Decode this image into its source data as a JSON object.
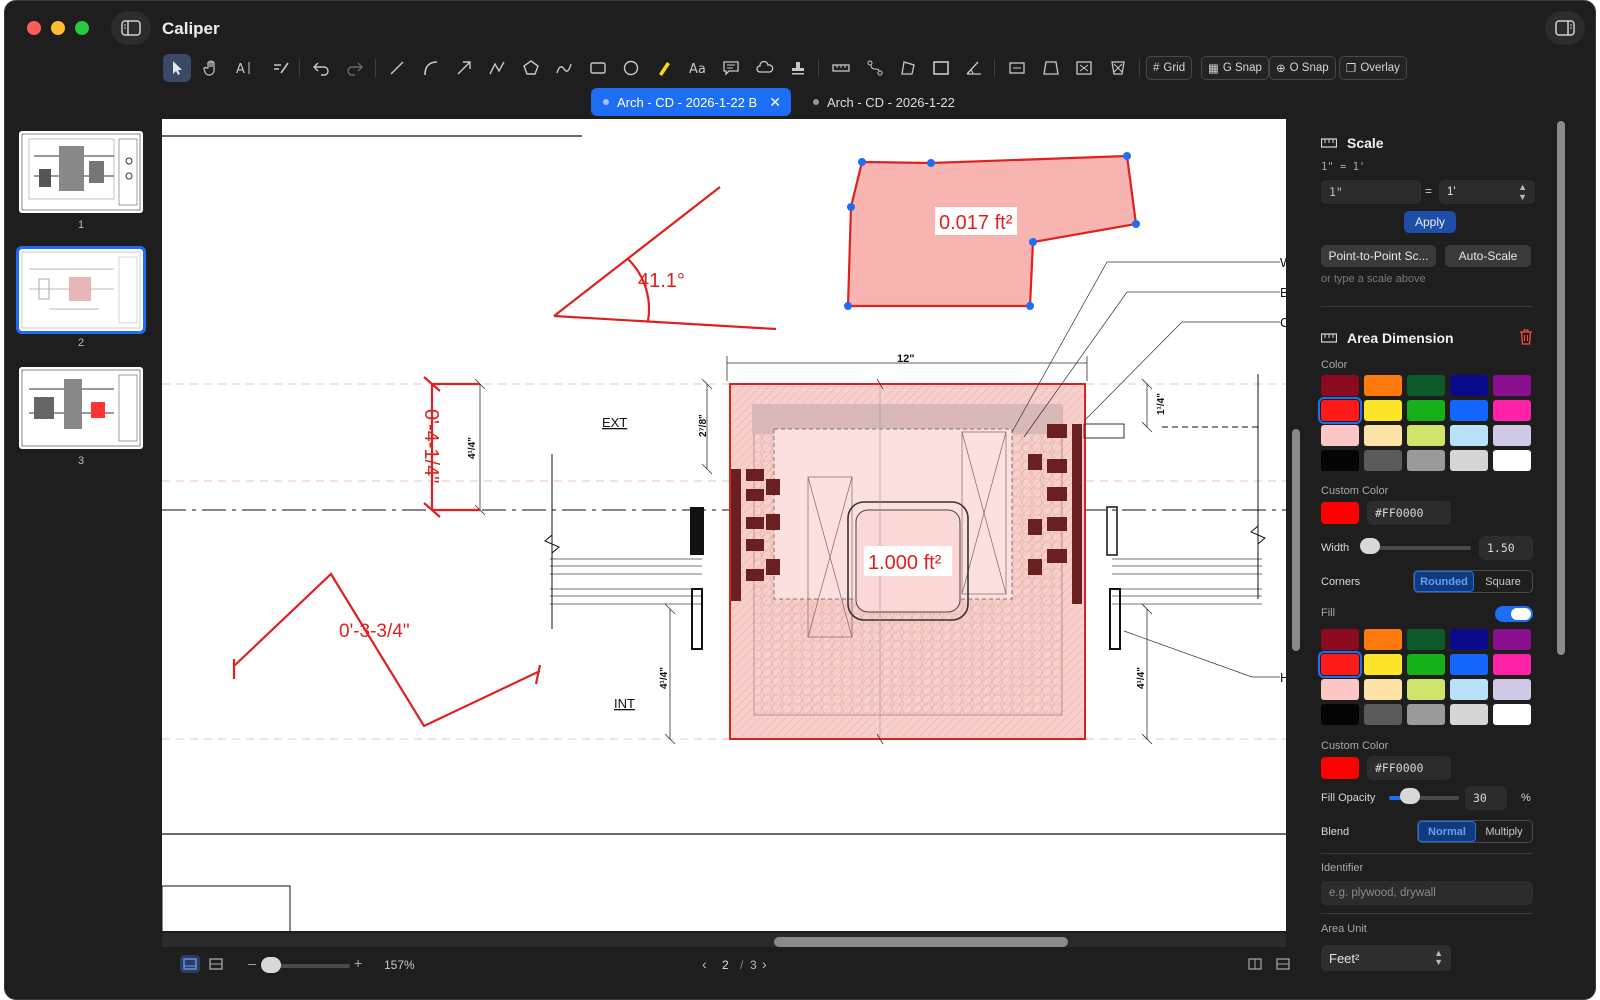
{
  "app": {
    "title": "Caliper"
  },
  "toolbar": {
    "tools": [
      "select-arrow-icon",
      "hand-pan-icon",
      "text-select-icon",
      "markup-pen-icon",
      "undo-icon",
      "redo-icon",
      "line-icon",
      "arc-icon",
      "arrow-icon",
      "polyline-icon",
      "polygon-icon",
      "freehand-icon",
      "rectangle-icon",
      "ellipse-icon",
      "highlighter-icon",
      "text-icon",
      "comment-icon",
      "cloud-icon",
      "stamp-icon",
      "ruler-icon",
      "path-measure-icon",
      "area-polygon-icon",
      "rect-area-icon",
      "angle-icon",
      "dimension-icon",
      "perimeter-icon",
      "cutout-icon",
      "count-icon"
    ],
    "grid_label": "Grid",
    "gsnap_label": "G Snap",
    "osnap_label": "O Snap",
    "overlay_label": "Overlay"
  },
  "tabs": [
    {
      "label": "Arch - CD - 2026-1-22 B",
      "active": true
    },
    {
      "label": "Arch - CD - 2026-1-22",
      "active": false
    }
  ],
  "thumbnails": [
    {
      "page": "1"
    },
    {
      "page": "2",
      "selected": true
    },
    {
      "page": "3"
    }
  ],
  "canvas": {
    "area_small": "0.017 ft²",
    "area_large": "1.000 ft²",
    "angle": "41.1°",
    "dim_vertical_red": "0'-4-1/4\"",
    "dim_zigzag": "0'-3-3/4\"",
    "dim_top": "12\"",
    "dim_left_small": "2⁷/8\"",
    "dim_4_1_4": "4¹/4\"",
    "dim_1_1_4": "1¹/4\"",
    "label_ext": "EXT",
    "label_int": "INT",
    "callouts": [
      "W",
      "B",
      "C",
      "H"
    ]
  },
  "statusbar": {
    "zoom": "157%",
    "zoom_level_pct": 8,
    "page_current": "2",
    "page_sep": "/",
    "page_total": "3"
  },
  "scale": {
    "title": "Scale",
    "current": "1\" = 1'",
    "input_left": "1\"",
    "equals": "=",
    "input_right": "1'",
    "apply": "Apply",
    "point_to_point": "Point-to-Point Sc...",
    "auto_scale": "Auto-Scale",
    "hint": "or type a scale above"
  },
  "area_dimension": {
    "title": "Area Dimension",
    "color_label": "Color",
    "custom_color_label": "Custom Color",
    "custom_color": "#FF0000",
    "width_label": "Width",
    "width_value": "1.50",
    "width_level_pct": 8,
    "corners_label": "Corners",
    "corners_options": [
      "Rounded",
      "Square"
    ],
    "fill_label": "Fill",
    "fill_enabled": true,
    "fill_custom_color_label": "Custom Color",
    "fill_custom_color": "#FF0000",
    "fill_opacity_label": "Fill Opacity",
    "fill_opacity_value": "30",
    "fill_opacity_unit": "%",
    "blend_label": "Blend",
    "blend_options": [
      "Normal",
      "Multiply"
    ],
    "identifier_label": "Identifier",
    "identifier_placeholder": "e.g. plywood, drywall",
    "area_unit_label": "Area Unit",
    "area_unit_value": "Feet²"
  },
  "palette": [
    "#8b0a1e",
    "#ff7a0e",
    "#0f5a2a",
    "#0a0a8a",
    "#8a108f",
    "#ff1a1a",
    "#ffe52a",
    "#16b01a",
    "#1466ff",
    "#ff22a8",
    "#ffc6c6",
    "#fde3a8",
    "#cfe46a",
    "#b9e2f8",
    "#cfc9e6",
    "#050505",
    "#5a5a5a",
    "#9a9a9a",
    "#d6d6d6",
    "#ffffff"
  ],
  "colors": {
    "accent": "#1e6ef5",
    "markup_red": "#e0201e",
    "area_fill": "#f7b4b0"
  }
}
